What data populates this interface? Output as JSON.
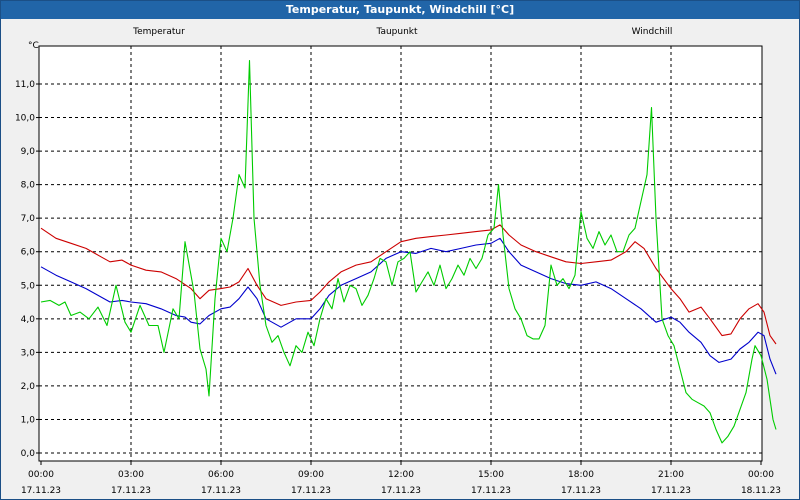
{
  "window": {
    "title": "Temperatur, Taupunkt, Windchill [°C]"
  },
  "chart_data": {
    "type": "line",
    "title": "Temperatur, Taupunkt, Windchill [°C]",
    "ylabel": "°C",
    "xlabel": "",
    "ylim": [
      -0.2,
      12.3
    ],
    "xlim": [
      0,
      24
    ],
    "grid": true,
    "legend_position": "top",
    "y_ticks": [
      "0,0",
      "1,0",
      "2,0",
      "3,0",
      "4,0",
      "5,0",
      "6,0",
      "7,0",
      "8,0",
      "9,0",
      "10,0",
      "11,0"
    ],
    "x_ticks": [
      {
        "time": "00:00",
        "date": "17.11.23"
      },
      {
        "time": "03:00",
        "date": "17.11.23"
      },
      {
        "time": "06:00",
        "date": "17.11.23"
      },
      {
        "time": "09:00",
        "date": "17.11.23"
      },
      {
        "time": "12:00",
        "date": "17.11.23"
      },
      {
        "time": "15:00",
        "date": "17.11.23"
      },
      {
        "time": "18:00",
        "date": "17.11.23"
      },
      {
        "time": "21:00",
        "date": "17.11.23"
      },
      {
        "time": "00:00",
        "date": "18.11.23"
      }
    ],
    "series": [
      {
        "name": "Temperatur",
        "color": "#cc0000",
        "points": [
          [
            0,
            6.7
          ],
          [
            0.5,
            6.4
          ],
          [
            1,
            6.25
          ],
          [
            1.5,
            6.1
          ],
          [
            2,
            5.85
          ],
          [
            2.3,
            5.7
          ],
          [
            2.7,
            5.75
          ],
          [
            3,
            5.6
          ],
          [
            3.5,
            5.45
          ],
          [
            4,
            5.4
          ],
          [
            4.5,
            5.2
          ],
          [
            5,
            4.9
          ],
          [
            5.3,
            4.6
          ],
          [
            5.6,
            4.85
          ],
          [
            6,
            4.9
          ],
          [
            6.3,
            4.95
          ],
          [
            6.6,
            5.1
          ],
          [
            6.9,
            5.5
          ],
          [
            7.2,
            5.0
          ],
          [
            7.5,
            4.6
          ],
          [
            8,
            4.4
          ],
          [
            8.5,
            4.5
          ],
          [
            9,
            4.55
          ],
          [
            9.3,
            4.8
          ],
          [
            9.6,
            5.1
          ],
          [
            10,
            5.4
          ],
          [
            10.5,
            5.6
          ],
          [
            11,
            5.7
          ],
          [
            11.5,
            6.0
          ],
          [
            12,
            6.3
          ],
          [
            12.5,
            6.4
          ],
          [
            13,
            6.45
          ],
          [
            13.5,
            6.5
          ],
          [
            14,
            6.55
          ],
          [
            14.5,
            6.6
          ],
          [
            15,
            6.65
          ],
          [
            15.3,
            6.8
          ],
          [
            15.6,
            6.5
          ],
          [
            16,
            6.2
          ],
          [
            16.5,
            6.0
          ],
          [
            17,
            5.85
          ],
          [
            17.5,
            5.7
          ],
          [
            18,
            5.65
          ],
          [
            18.5,
            5.7
          ],
          [
            19,
            5.75
          ],
          [
            19.5,
            6.0
          ],
          [
            19.8,
            6.3
          ],
          [
            20.1,
            6.1
          ],
          [
            20.5,
            5.5
          ],
          [
            21,
            4.9
          ],
          [
            21.3,
            4.6
          ],
          [
            21.6,
            4.2
          ],
          [
            22,
            4.35
          ],
          [
            22.3,
            4.0
          ],
          [
            22.7,
            3.5
          ],
          [
            23,
            3.55
          ],
          [
            23.3,
            4.0
          ],
          [
            23.6,
            4.3
          ],
          [
            23.9,
            4.45
          ],
          [
            24.1,
            4.2
          ],
          [
            24.3,
            3.5
          ],
          [
            24.5,
            3.25
          ]
        ]
      },
      {
        "name": "Taupunkt",
        "color": "#0000cc",
        "points": [
          [
            0,
            5.55
          ],
          [
            0.5,
            5.3
          ],
          [
            1,
            5.1
          ],
          [
            1.5,
            4.9
          ],
          [
            2,
            4.65
          ],
          [
            2.3,
            4.5
          ],
          [
            2.7,
            4.55
          ],
          [
            3,
            4.5
          ],
          [
            3.5,
            4.45
          ],
          [
            4,
            4.3
          ],
          [
            4.5,
            4.1
          ],
          [
            4.8,
            4.05
          ],
          [
            5,
            3.9
          ],
          [
            5.3,
            3.85
          ],
          [
            5.6,
            4.1
          ],
          [
            6,
            4.3
          ],
          [
            6.3,
            4.35
          ],
          [
            6.6,
            4.6
          ],
          [
            6.9,
            4.95
          ],
          [
            7.2,
            4.6
          ],
          [
            7.5,
            4.0
          ],
          [
            8,
            3.75
          ],
          [
            8.5,
            4.0
          ],
          [
            9,
            4.0
          ],
          [
            9.3,
            4.3
          ],
          [
            9.6,
            4.7
          ],
          [
            10,
            5.0
          ],
          [
            10.5,
            5.2
          ],
          [
            11,
            5.4
          ],
          [
            11.5,
            5.8
          ],
          [
            12,
            6.0
          ],
          [
            12.5,
            5.95
          ],
          [
            13,
            6.1
          ],
          [
            13.5,
            6.0
          ],
          [
            14,
            6.1
          ],
          [
            14.5,
            6.2
          ],
          [
            15,
            6.25
          ],
          [
            15.3,
            6.4
          ],
          [
            15.6,
            6.0
          ],
          [
            16,
            5.6
          ],
          [
            16.5,
            5.4
          ],
          [
            17,
            5.2
          ],
          [
            17.5,
            5.05
          ],
          [
            18,
            5.0
          ],
          [
            18.5,
            5.1
          ],
          [
            19,
            4.9
          ],
          [
            19.5,
            4.6
          ],
          [
            20,
            4.3
          ],
          [
            20.5,
            3.9
          ],
          [
            21,
            4.05
          ],
          [
            21.3,
            3.9
          ],
          [
            21.6,
            3.6
          ],
          [
            22,
            3.3
          ],
          [
            22.3,
            2.9
          ],
          [
            22.6,
            2.7
          ],
          [
            23,
            2.8
          ],
          [
            23.3,
            3.1
          ],
          [
            23.6,
            3.3
          ],
          [
            23.9,
            3.6
          ],
          [
            24.1,
            3.5
          ],
          [
            24.3,
            2.8
          ],
          [
            24.5,
            2.35
          ]
        ]
      },
      {
        "name": "Windchill",
        "color": "#00cc00",
        "points": [
          [
            0,
            4.5
          ],
          [
            0.3,
            4.55
          ],
          [
            0.6,
            4.4
          ],
          [
            0.8,
            4.5
          ],
          [
            1,
            4.1
          ],
          [
            1.3,
            4.2
          ],
          [
            1.6,
            4.0
          ],
          [
            1.9,
            4.35
          ],
          [
            2.2,
            3.8
          ],
          [
            2.5,
            5.0
          ],
          [
            2.8,
            3.9
          ],
          [
            3,
            3.6
          ],
          [
            3.3,
            4.4
          ],
          [
            3.6,
            3.8
          ],
          [
            3.9,
            3.8
          ],
          [
            4.1,
            3.0
          ],
          [
            4.4,
            4.3
          ],
          [
            4.6,
            4.0
          ],
          [
            4.8,
            6.3
          ],
          [
            5.1,
            4.8
          ],
          [
            5.3,
            3.1
          ],
          [
            5.5,
            2.5
          ],
          [
            5.6,
            1.7
          ],
          [
            5.8,
            4.6
          ],
          [
            6,
            6.4
          ],
          [
            6.2,
            6.0
          ],
          [
            6.4,
            7.0
          ],
          [
            6.6,
            8.3
          ],
          [
            6.8,
            7.9
          ],
          [
            6.95,
            11.7
          ],
          [
            7.1,
            7.0
          ],
          [
            7.3,
            5.0
          ],
          [
            7.5,
            3.8
          ],
          [
            7.7,
            3.3
          ],
          [
            7.9,
            3.5
          ],
          [
            8.1,
            3.0
          ],
          [
            8.3,
            2.6
          ],
          [
            8.5,
            3.2
          ],
          [
            8.7,
            3.0
          ],
          [
            8.9,
            3.6
          ],
          [
            9.1,
            3.2
          ],
          [
            9.3,
            4.0
          ],
          [
            9.5,
            4.6
          ],
          [
            9.7,
            4.3
          ],
          [
            9.9,
            5.2
          ],
          [
            10.1,
            4.5
          ],
          [
            10.3,
            5.0
          ],
          [
            10.5,
            4.9
          ],
          [
            10.7,
            4.4
          ],
          [
            10.9,
            4.7
          ],
          [
            11.1,
            5.2
          ],
          [
            11.3,
            5.8
          ],
          [
            11.5,
            5.7
          ],
          [
            11.7,
            5.0
          ],
          [
            11.9,
            5.7
          ],
          [
            12.1,
            5.8
          ],
          [
            12.3,
            6.0
          ],
          [
            12.5,
            4.8
          ],
          [
            12.7,
            5.1
          ],
          [
            12.9,
            5.4
          ],
          [
            13.1,
            5.0
          ],
          [
            13.3,
            5.6
          ],
          [
            13.5,
            4.9
          ],
          [
            13.7,
            5.2
          ],
          [
            13.9,
            5.6
          ],
          [
            14.1,
            5.3
          ],
          [
            14.3,
            5.8
          ],
          [
            14.5,
            5.5
          ],
          [
            14.7,
            5.8
          ],
          [
            14.9,
            6.5
          ],
          [
            15.1,
            6.7
          ],
          [
            15.25,
            8.0
          ],
          [
            15.4,
            6.5
          ],
          [
            15.6,
            4.9
          ],
          [
            15.8,
            4.3
          ],
          [
            16,
            4.0
          ],
          [
            16.2,
            3.5
          ],
          [
            16.4,
            3.4
          ],
          [
            16.6,
            3.4
          ],
          [
            16.8,
            3.8
          ],
          [
            17,
            5.6
          ],
          [
            17.2,
            5.0
          ],
          [
            17.4,
            5.2
          ],
          [
            17.6,
            4.9
          ],
          [
            17.8,
            5.3
          ],
          [
            18,
            7.2
          ],
          [
            18.2,
            6.4
          ],
          [
            18.4,
            6.1
          ],
          [
            18.6,
            6.6
          ],
          [
            18.8,
            6.2
          ],
          [
            19,
            6.5
          ],
          [
            19.2,
            6.0
          ],
          [
            19.4,
            6.0
          ],
          [
            19.6,
            6.5
          ],
          [
            19.8,
            6.7
          ],
          [
            20,
            7.5
          ],
          [
            20.2,
            8.3
          ],
          [
            20.35,
            10.3
          ],
          [
            20.5,
            7.0
          ],
          [
            20.7,
            4.0
          ],
          [
            20.9,
            3.5
          ],
          [
            21.1,
            3.2
          ],
          [
            21.3,
            2.5
          ],
          [
            21.5,
            1.8
          ],
          [
            21.7,
            1.6
          ],
          [
            21.9,
            1.5
          ],
          [
            22.1,
            1.4
          ],
          [
            22.3,
            1.2
          ],
          [
            22.5,
            0.7
          ],
          [
            22.7,
            0.3
          ],
          [
            22.9,
            0.5
          ],
          [
            23.1,
            0.8
          ],
          [
            23.3,
            1.3
          ],
          [
            23.5,
            1.8
          ],
          [
            23.7,
            2.8
          ],
          [
            23.8,
            3.2
          ],
          [
            24,
            2.9
          ],
          [
            24.2,
            2.2
          ],
          [
            24.4,
            1.0
          ],
          [
            24.5,
            0.7
          ]
        ]
      }
    ]
  }
}
